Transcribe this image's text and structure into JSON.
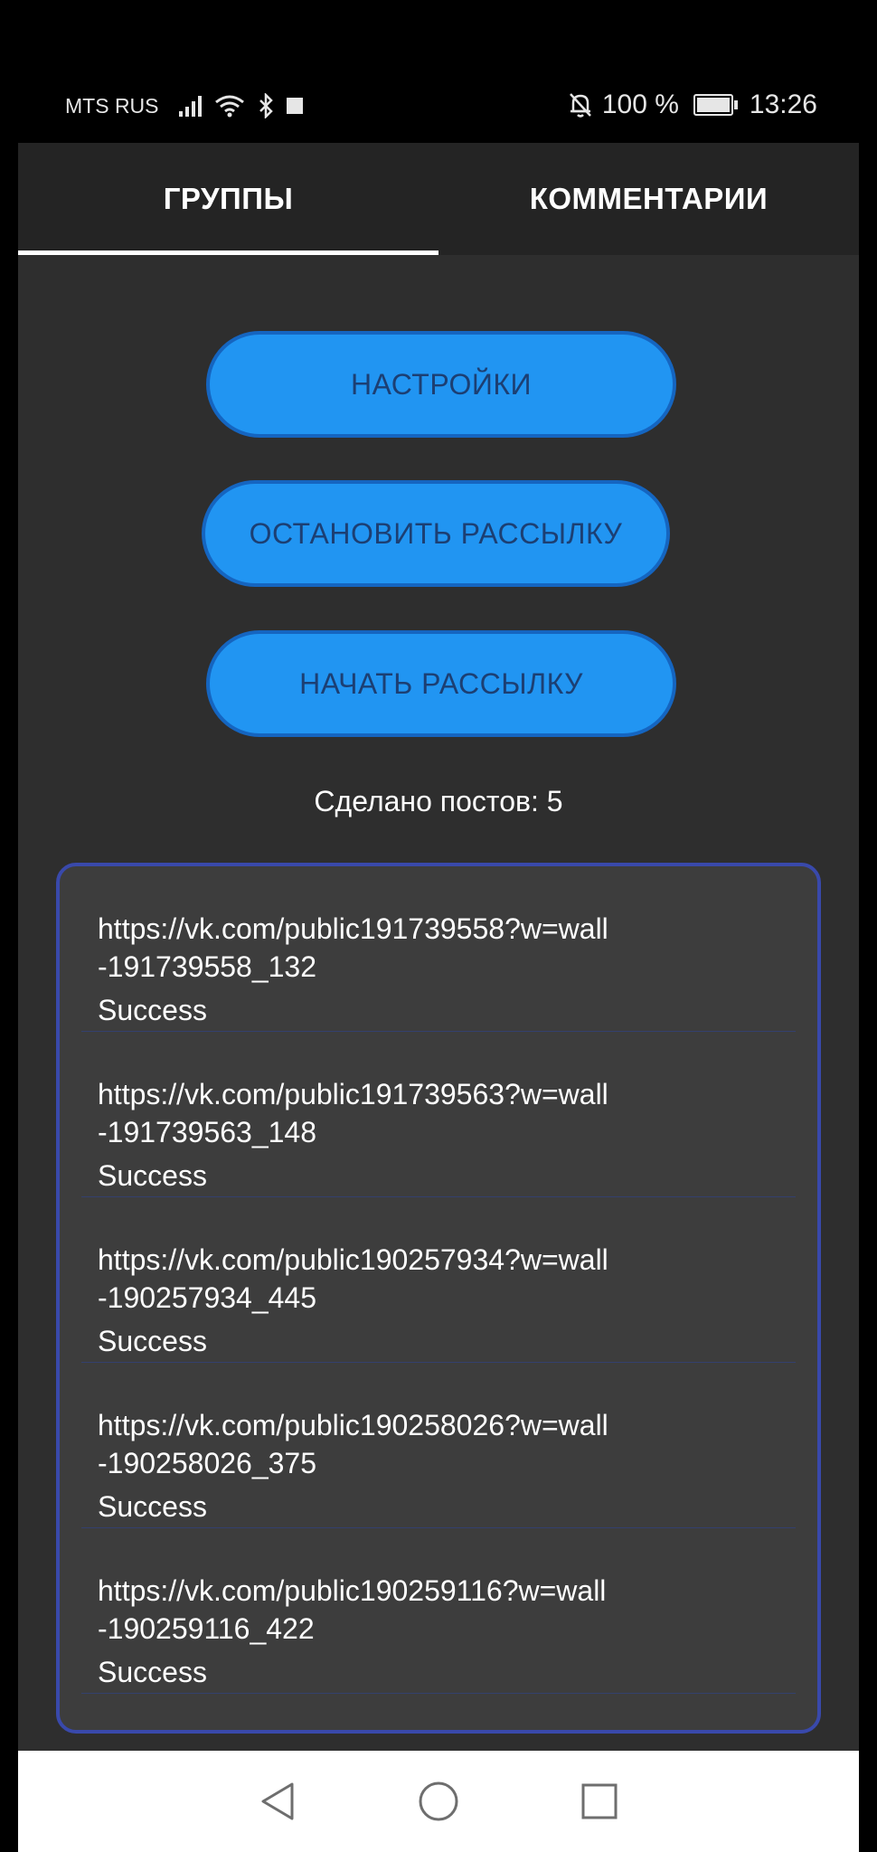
{
  "status_bar": {
    "carrier": "MTS RUS",
    "battery_percent": "100 %",
    "time": "13:26",
    "icons": [
      "signal-icon",
      "wifi-icon",
      "bluetooth-icon",
      "square-icon",
      "mute-bell-icon",
      "battery-icon"
    ]
  },
  "tabs": [
    {
      "label": "ГРУППЫ",
      "active": true
    },
    {
      "label": "КОММЕНТАРИИ",
      "active": false
    }
  ],
  "buttons": {
    "settings": "НАСТРОЙКИ",
    "stop": "ОСТАНОВИТЬ РАССЫЛКУ",
    "start": "НАЧАТЬ РАССЫЛКУ"
  },
  "posts_count_text": "Сделано постов: 5",
  "posts": [
    {
      "url_line1": "https://vk.com/public191739558?w=wall",
      "url_line2": "-191739558_132",
      "status": "Success"
    },
    {
      "url_line1": "https://vk.com/public191739563?w=wall",
      "url_line2": "-191739563_148",
      "status": "Success"
    },
    {
      "url_line1": "https://vk.com/public190257934?w=wall",
      "url_line2": "-190257934_445",
      "status": "Success"
    },
    {
      "url_line1": "https://vk.com/public190258026?w=wall",
      "url_line2": "-190258026_375",
      "status": "Success"
    },
    {
      "url_line1": "https://vk.com/public190259116?w=wall",
      "url_line2": "-190259116_422",
      "status": "Success"
    }
  ],
  "colors": {
    "button_fill": "#2195f2",
    "button_border": "#1565c0",
    "list_border": "#3949ab",
    "background": "#2e2e2e"
  },
  "nav_icons": [
    "back-triangle-icon",
    "home-circle-icon",
    "recents-square-icon"
  ]
}
